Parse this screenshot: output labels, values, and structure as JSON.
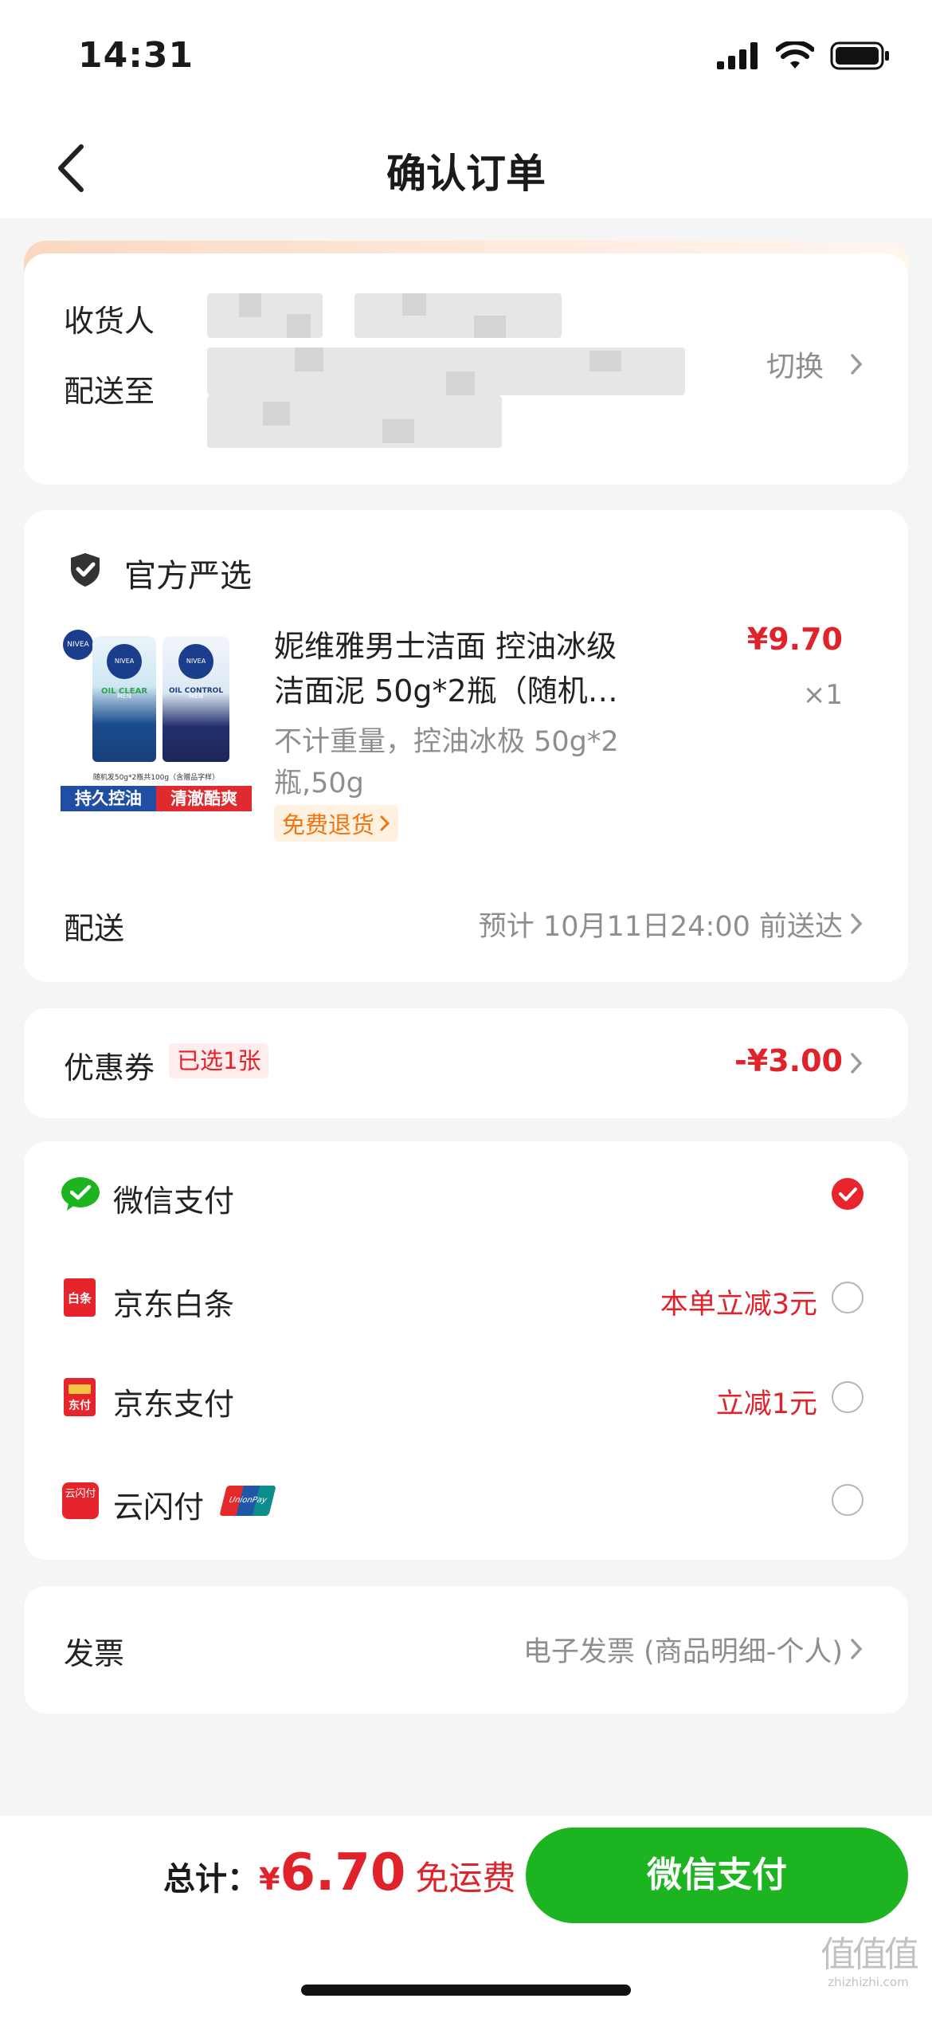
{
  "status_bar": {
    "time": "14:31"
  },
  "nav": {
    "title": "确认订单"
  },
  "address": {
    "receiver_label": "收货人",
    "deliver_label": "配送至",
    "switch_label": "切换"
  },
  "product": {
    "shop_label": "官方严选",
    "name_line1": "妮维雅男士洁面 控油冰级",
    "name_line2": "洁面泥 50g*2瓶（随机…",
    "spec_line1": "不计重量，控油冰极 50g*2",
    "spec_line2": "瓶,50g",
    "free_return": "免费退货",
    "price": "¥9.70",
    "qty": "×1",
    "image_text": {
      "brand": "NIVEA MEN",
      "tube1": "OIL CLEAR",
      "tube2": "OIL CONTROL",
      "caption": "随机发50g*2瓶共100g（含赠品字样）",
      "tag1": "持久控油",
      "tag2": "清澈酷爽"
    }
  },
  "delivery": {
    "label": "配送",
    "value": "预计 10月11日24:00 前送达"
  },
  "coupon": {
    "label": "优惠券",
    "badge": "已选1张",
    "value": "-¥3.00"
  },
  "payment": {
    "methods": [
      {
        "name": "微信支付",
        "promo": "",
        "selected": true
      },
      {
        "name": "京东白条",
        "promo": "本单立减3元",
        "selected": false
      },
      {
        "name": "京东支付",
        "promo": "立减1元",
        "selected": false
      },
      {
        "name": "云闪付",
        "promo": "",
        "selected": false
      }
    ],
    "icon_text": {
      "baitiao": "白条",
      "jdpay": "东付",
      "yunshanfu": "云闪付",
      "unionpay": "UnionPay"
    }
  },
  "invoice": {
    "label": "发票",
    "value": "电子发票 (商品明细-个人)"
  },
  "footer": {
    "total_label": "总计：",
    "currency": "¥",
    "amount": "6.70",
    "shipping": "免运费",
    "pay_button": "微信支付"
  },
  "watermark": {
    "chars": "值值值",
    "url": "zhizhizhi.com"
  },
  "colors": {
    "accent_red": "#e0222a",
    "wechat_green": "#1cb421",
    "free_return_bg": "#fff1df",
    "free_return_text": "#f07410"
  }
}
